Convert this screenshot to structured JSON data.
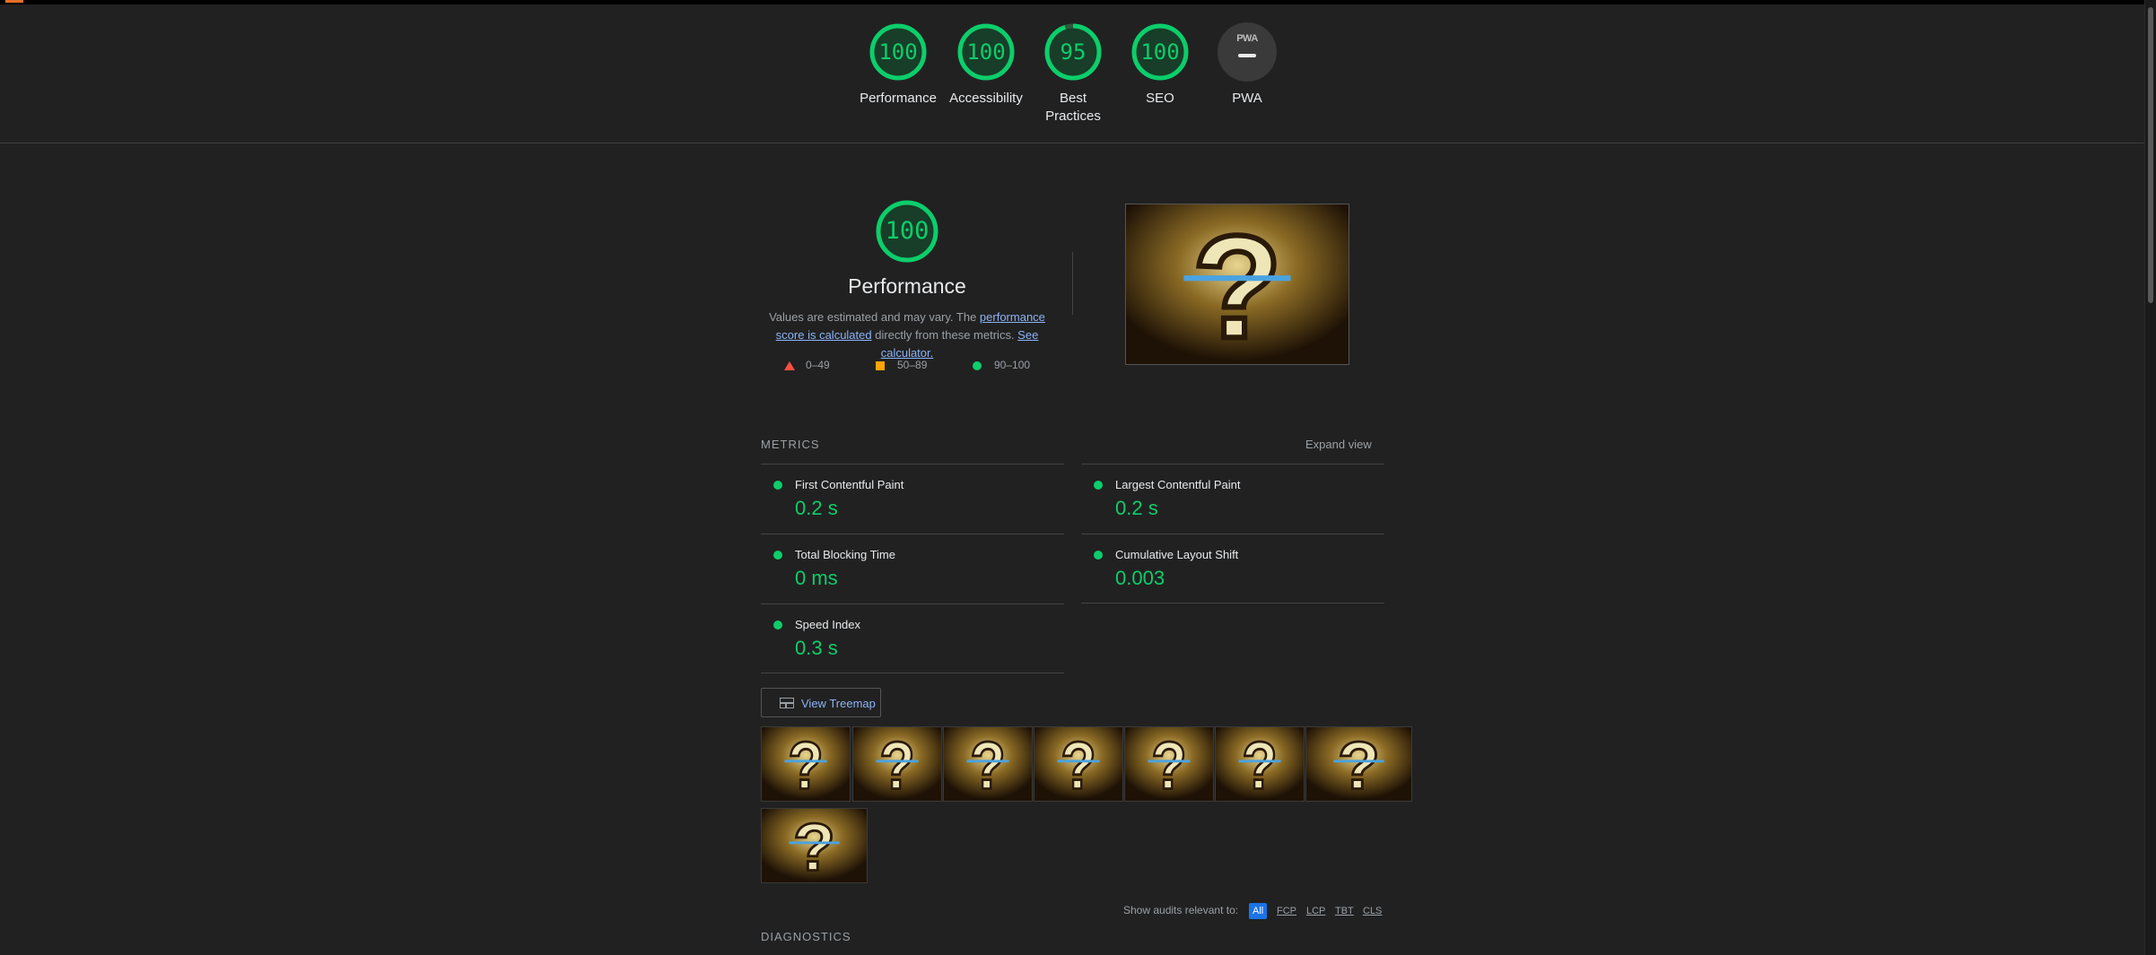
{
  "categories": [
    {
      "key": "performance",
      "score": "100",
      "label": "Performance"
    },
    {
      "key": "accessibility",
      "score": "100",
      "label": "Accessibility"
    },
    {
      "key": "best-practices",
      "score": "95",
      "label": "Best Practices"
    },
    {
      "key": "seo",
      "score": "100",
      "label": "SEO"
    },
    {
      "key": "pwa",
      "score": "",
      "badge": "PWA",
      "label": "PWA"
    }
  ],
  "perf": {
    "score": "100",
    "title": "Performance",
    "desc_prefix": "Values are estimated and may vary. The ",
    "desc_link1": "performance score is calculated",
    "desc_middle": " directly from these metrics. ",
    "desc_link2": "See calculator."
  },
  "legend": {
    "fail": "0–49",
    "average": "50–89",
    "pass": "90–100"
  },
  "metrics": {
    "heading": "METRICS",
    "expand": "Expand view",
    "fcp": {
      "name": "First Contentful Paint",
      "value": "0.2 s"
    },
    "lcp": {
      "name": "Largest Contentful Paint",
      "value": "0.2 s"
    },
    "tbt": {
      "name": "Total Blocking Time",
      "value": "0 ms"
    },
    "cls": {
      "name": "Cumulative Layout Shift",
      "value": "0.003"
    },
    "si": {
      "name": "Speed Index",
      "value": "0.3 s"
    }
  },
  "treemap_label": "View Treemap",
  "filter": {
    "label": "Show audits relevant to:",
    "chips": [
      "All",
      "FCP",
      "LCP",
      "TBT",
      "CLS"
    ],
    "active": "All"
  },
  "diagnostics_heading": "DIAGNOSTICS",
  "colors": {
    "pass": "#0cce6b",
    "average": "#ffa400",
    "fail": "#ff4e42",
    "link": "#8ab4f8",
    "bg": "#212121"
  }
}
